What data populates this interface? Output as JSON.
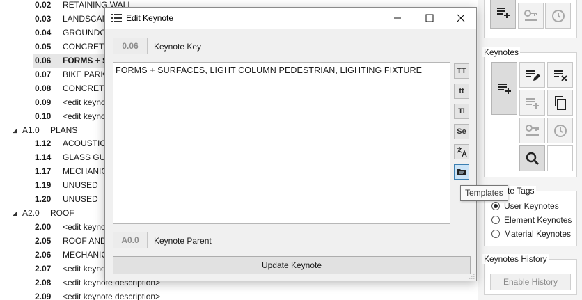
{
  "tree": {
    "rows_top": [
      {
        "code": "0.02",
        "desc": "RETAINING WALL"
      },
      {
        "code": "0.03",
        "desc": "LANDSCAPE"
      },
      {
        "code": "0.04",
        "desc": "GROUNDCOVER"
      },
      {
        "code": "0.05",
        "desc": "CONCRETE"
      },
      {
        "code": "0.06",
        "desc": "FORMS + SURFACES"
      },
      {
        "code": "0.07",
        "desc": "BIKE PARKING"
      },
      {
        "code": "0.08",
        "desc": "CONCRETE"
      },
      {
        "code": "0.09",
        "desc": "<edit keynote description>"
      },
      {
        "code": "0.10",
        "desc": "<edit keynote description>"
      }
    ],
    "group_a1": {
      "code": "A1.0",
      "name": "PLANS"
    },
    "rows_a1": [
      {
        "code": "1.12",
        "desc": "ACOUSTIC"
      },
      {
        "code": "1.14",
        "desc": "GLASS GUARD"
      },
      {
        "code": "1.17",
        "desc": "MECHANICAL"
      },
      {
        "code": "1.19",
        "desc": "UNUSED"
      },
      {
        "code": "1.20",
        "desc": "UNUSED"
      }
    ],
    "group_a2": {
      "code": "A2.0",
      "name": "ROOF"
    },
    "rows_a2": [
      {
        "code": "2.00",
        "desc": "<edit keynote description>"
      },
      {
        "code": "2.05",
        "desc": "ROOF AND"
      },
      {
        "code": "2.06",
        "desc": "MECHANICAL"
      },
      {
        "code": "2.07",
        "desc": "<edit keynote description>"
      },
      {
        "code": "2.08",
        "desc": "<edit keynote description>"
      },
      {
        "code": "2.09",
        "desc": "<edit keynote description>"
      }
    ]
  },
  "right_panel": {
    "keynotes_title": "Keynotes",
    "tags_title": "Keynote Tags",
    "tag_options": [
      "User Keynotes",
      "Element Keynotes",
      "Material Keynotes"
    ],
    "selected_tag": "User Keynotes",
    "history_title": "Keynotes History",
    "enable_history_label": "Enable History"
  },
  "dialog": {
    "title": "Edit Keynote",
    "keynote_key_value": "0.06",
    "keynote_key_label": "Keynote Key",
    "description": "FORMS + SURFACES, LIGHT COLUMN PEDESTRIAN, LIGHTING FIXTURE",
    "side_buttons": [
      "TT",
      "tt",
      "Ti",
      "Se"
    ],
    "keynote_parent_value": "A0.0",
    "keynote_parent_label": "Keynote Parent",
    "update_label": "Update Keynote"
  },
  "tooltip": "Templates",
  "colors": {
    "active_button_bg": "#cce4f7",
    "active_button_border": "#3c7fb1",
    "disabled_text": "#8c8c8c"
  }
}
